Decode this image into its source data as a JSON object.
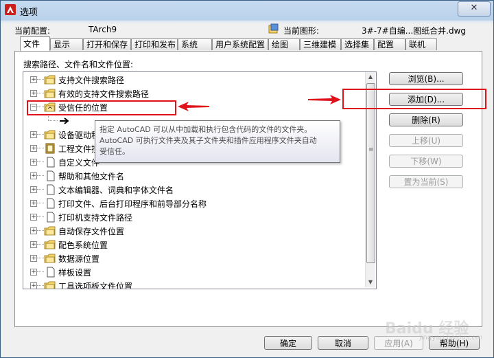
{
  "window": {
    "title": "选项",
    "close": "✕"
  },
  "profile": {
    "label": "当前配置:",
    "value": "TArch9"
  },
  "drawing": {
    "label": "当前图形:",
    "value": "3#-7#自编...图纸合并.dwg"
  },
  "tabs": [
    {
      "label": "文件",
      "active": true
    },
    {
      "label": "显示"
    },
    {
      "label": "打开和保存"
    },
    {
      "label": "打印和发布"
    },
    {
      "label": "系统"
    },
    {
      "label": "用户系统配置"
    },
    {
      "label": "绘图"
    },
    {
      "label": "三维建模"
    },
    {
      "label": "选择集"
    },
    {
      "label": "配置"
    },
    {
      "label": "联机"
    }
  ],
  "panel_label": "搜索路径、文件名和文件位置:",
  "tree": [
    {
      "label": "支持文件搜索路径",
      "icon": "folder-icon",
      "expander": "+"
    },
    {
      "label": "有效的支持文件搜索路径",
      "icon": "folder-icon",
      "expander": "+"
    },
    {
      "label": "受信任的位置",
      "icon": "trusted-folder-icon",
      "expander": "−"
    },
    {
      "label": "",
      "icon": "arrow-right-icon",
      "expander": ""
    },
    {
      "label": "设备驱动程",
      "icon": "folder-icon",
      "expander": "+"
    },
    {
      "label": "工程文件搜",
      "icon": "book-icon",
      "expander": "+"
    },
    {
      "label": "自定义文件",
      "icon": "file-icon",
      "expander": "+"
    },
    {
      "label": "帮助和其他文件名",
      "icon": "file-icon",
      "expander": "+"
    },
    {
      "label": "文本编辑器、词典和字体文件名",
      "icon": "file-icon",
      "expander": "+"
    },
    {
      "label": "打印文件、后台打印程序和前导部分名称",
      "icon": "file-icon",
      "expander": "+"
    },
    {
      "label": "打印机支持文件路径",
      "icon": "file-icon",
      "expander": "+"
    },
    {
      "label": "自动保存文件位置",
      "icon": "folder-icon",
      "expander": "+"
    },
    {
      "label": "配色系统位置",
      "icon": "folder-icon",
      "expander": "+"
    },
    {
      "label": "数据源位置",
      "icon": "folder-icon",
      "expander": "+"
    },
    {
      "label": "样板设置",
      "icon": "file-icon",
      "expander": "+"
    },
    {
      "label": "工具选项板文件位置",
      "icon": "folder-icon",
      "expander": "+"
    }
  ],
  "tooltip": {
    "line1": "指定 AutoCAD 可以从中加载和执行包含代码的文件的文件夹。",
    "line2": "AutoCAD 可执行文件夹及其子文件夹和插件应用程序文件夹自动",
    "line3": "受信任。"
  },
  "buttons": {
    "browse": "浏览(B)...",
    "add": "添加(D)...",
    "delete": "删除(R)",
    "move_up": "上移(U)",
    "move_down": "下移(W)",
    "set_current": "置为当前(S)"
  },
  "footer": {
    "ok": "确定",
    "cancel": "取消",
    "apply": "应用(A)",
    "help": "帮助(H)"
  },
  "watermark": {
    "main": "Baidu 经验",
    "sub": "jingyan.baidu.com"
  },
  "colors": {
    "annotation": "#e0131b",
    "title_bar": "#b9d1ea"
  }
}
